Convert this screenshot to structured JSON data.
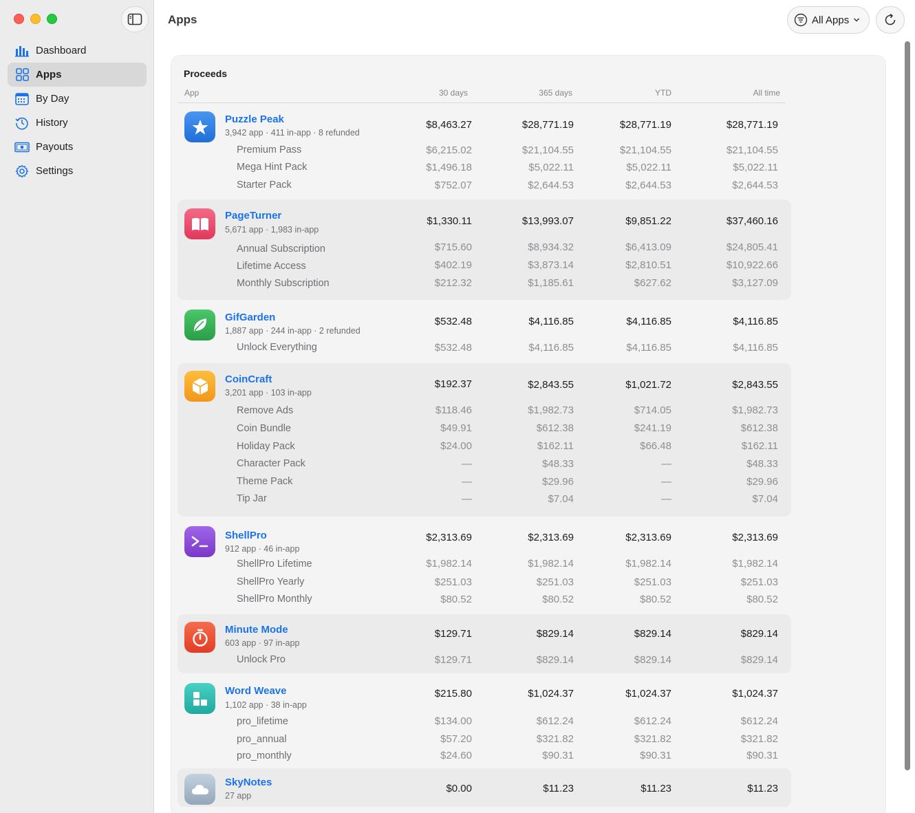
{
  "sidebar": {
    "items": [
      {
        "label": "Dashboard",
        "icon": "chart-bar-icon",
        "active": false
      },
      {
        "label": "Apps",
        "icon": "grid-icon",
        "active": true
      },
      {
        "label": "By Day",
        "icon": "calendar-icon",
        "active": false
      },
      {
        "label": "History",
        "icon": "clock-history-icon",
        "active": false
      },
      {
        "label": "Payouts",
        "icon": "banknote-icon",
        "active": false
      },
      {
        "label": "Settings",
        "icon": "gear-icon",
        "active": false
      }
    ]
  },
  "header": {
    "title": "Apps",
    "filter_label": "All Apps"
  },
  "colors": {
    "accent": "#1a73e8",
    "sidebar_icon": "#1a73e8"
  },
  "table": {
    "title": "Proceeds",
    "columns": [
      "App",
      "30 days",
      "365 days",
      "YTD",
      "All time"
    ],
    "apps": [
      {
        "name": "Puzzle Peak",
        "sub": "3,942 app · 411 in-app · 8 refunded",
        "icon": "star-icon",
        "icon_color": "#2f7fe6",
        "values": [
          "$8,463.27",
          "$28,771.19",
          "$28,771.19",
          "$28,771.19"
        ],
        "items": [
          {
            "label": "Premium Pass",
            "values": [
              "$6,215.02",
              "$21,104.55",
              "$21,104.55",
              "$21,104.55"
            ]
          },
          {
            "label": "Mega Hint Pack",
            "values": [
              "$1,496.18",
              "$5,022.11",
              "$5,022.11",
              "$5,022.11"
            ]
          },
          {
            "label": "Starter Pack",
            "values": [
              "$752.07",
              "$2,644.53",
              "$2,644.53",
              "$2,644.53"
            ]
          }
        ]
      },
      {
        "name": "PageTurner",
        "sub": "5,671 app · 1,983 in-app",
        "icon": "book-icon",
        "icon_color": "#ec4a6a",
        "values": [
          "$1,330.11",
          "$13,993.07",
          "$9,851.22",
          "$37,460.16"
        ],
        "items": [
          {
            "label": "Annual Subscription",
            "values": [
              "$715.60",
              "$8,934.32",
              "$6,413.09",
              "$24,805.41"
            ]
          },
          {
            "label": "Lifetime Access",
            "values": [
              "$402.19",
              "$3,873.14",
              "$2,810.51",
              "$10,922.66"
            ]
          },
          {
            "label": "Monthly Subscription",
            "values": [
              "$212.32",
              "$1,185.61",
              "$627.62",
              "$3,127.09"
            ]
          }
        ]
      },
      {
        "name": "GifGarden",
        "sub": "1,887 app · 244 in-app · 2 refunded",
        "icon": "leaf-icon",
        "icon_color": "#35b155",
        "values": [
          "$532.48",
          "$4,116.85",
          "$4,116.85",
          "$4,116.85"
        ],
        "items": [
          {
            "label": "Unlock Everything",
            "values": [
              "$532.48",
              "$4,116.85",
              "$4,116.85",
              "$4,116.85"
            ]
          }
        ]
      },
      {
        "name": "CoinCraft",
        "sub": "3,201 app · 103 in-app",
        "icon": "cube-icon",
        "icon_color": "#f5a623",
        "values": [
          "$192.37",
          "$2,843.55",
          "$1,021.72",
          "$2,843.55"
        ],
        "items": [
          {
            "label": "Remove Ads",
            "values": [
              "$118.46",
              "$1,982.73",
              "$714.05",
              "$1,982.73"
            ]
          },
          {
            "label": "Coin Bundle",
            "values": [
              "$49.91",
              "$612.38",
              "$241.19",
              "$612.38"
            ]
          },
          {
            "label": "Holiday Pack",
            "values": [
              "$24.00",
              "$162.11",
              "$66.48",
              "$162.11"
            ]
          },
          {
            "label": "Character Pack",
            "values": [
              "—",
              "$48.33",
              "—",
              "$48.33"
            ]
          },
          {
            "label": "Theme Pack",
            "values": [
              "—",
              "$29.96",
              "—",
              "$29.96"
            ]
          },
          {
            "label": "Tip Jar",
            "values": [
              "—",
              "$7.04",
              "—",
              "$7.04"
            ]
          }
        ]
      },
      {
        "name": "ShellPro",
        "sub": "912 app · 46 in-app",
        "icon": "terminal-icon",
        "icon_color": "#8c4ad8",
        "values": [
          "$2,313.69",
          "$2,313.69",
          "$2,313.69",
          "$2,313.69"
        ],
        "items": [
          {
            "label": "ShellPro Lifetime",
            "values": [
              "$1,982.14",
              "$1,982.14",
              "$1,982.14",
              "$1,982.14"
            ]
          },
          {
            "label": "ShellPro Yearly",
            "values": [
              "$251.03",
              "$251.03",
              "$251.03",
              "$251.03"
            ]
          },
          {
            "label": "ShellPro Monthly",
            "values": [
              "$80.52",
              "$80.52",
              "$80.52",
              "$80.52"
            ]
          }
        ]
      },
      {
        "name": "Minute Mode",
        "sub": "603 app · 97 in-app",
        "icon": "timer-icon",
        "icon_color": "#ee5136",
        "values": [
          "$129.71",
          "$829.14",
          "$829.14",
          "$829.14"
        ],
        "items": [
          {
            "label": "Unlock Pro",
            "values": [
              "$129.71",
              "$829.14",
              "$829.14",
              "$829.14"
            ]
          }
        ]
      },
      {
        "name": "Word Weave",
        "sub": "1,102 app · 38 in-app",
        "icon": "tiles-icon",
        "icon_color": "#2fbfb3",
        "values": [
          "$215.80",
          "$1,024.37",
          "$1,024.37",
          "$1,024.37"
        ],
        "items": [
          {
            "label": "pro_lifetime",
            "values": [
              "$134.00",
              "$612.24",
              "$612.24",
              "$612.24"
            ]
          },
          {
            "label": "pro_annual",
            "values": [
              "$57.20",
              "$321.82",
              "$321.82",
              "$321.82"
            ]
          },
          {
            "label": "pro_monthly",
            "values": [
              "$24.60",
              "$90.31",
              "$90.31",
              "$90.31"
            ]
          }
        ]
      },
      {
        "name": "SkyNotes",
        "sub": "27 app",
        "icon": "cloud-icon",
        "icon_color": "#a9b9c9",
        "values": [
          "$0.00",
          "$11.23",
          "$11.23",
          "$11.23"
        ],
        "items": []
      }
    ]
  }
}
